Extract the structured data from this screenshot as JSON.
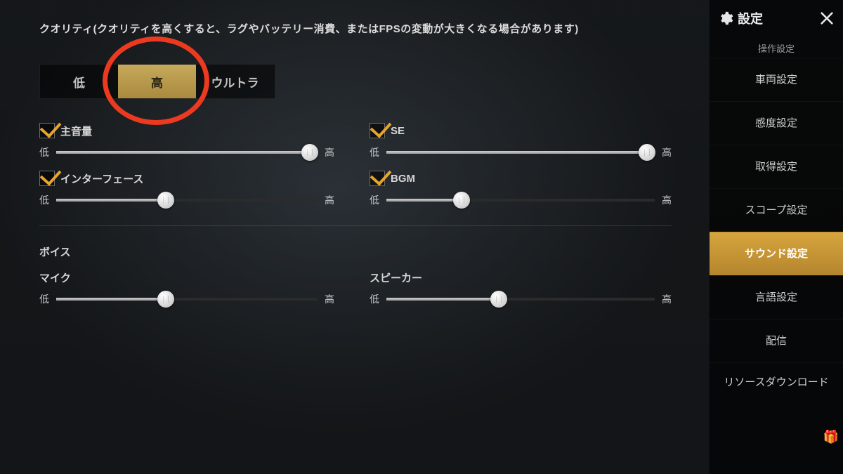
{
  "quality_note": "クオリティ(クオリティを高くすると、ラグやバッテリー消費、またはFPSの変動が大きくなる場合があります)",
  "quality_options": {
    "low": "低",
    "high": "高",
    "ultra": "ウルトラ",
    "selected": "high"
  },
  "labels": {
    "low": "低",
    "high": "高"
  },
  "sliders": {
    "master": {
      "label": "主音量",
      "checked": true,
      "value": 97
    },
    "se": {
      "label": "SE",
      "checked": true,
      "value": 97
    },
    "interface": {
      "label": "インターフェース",
      "checked": true,
      "value": 42
    },
    "bgm": {
      "label": "BGM",
      "checked": true,
      "value": 28
    },
    "mic": {
      "label": "マイク",
      "checked": false,
      "value": 42
    },
    "speaker": {
      "label": "スピーカー",
      "checked": false,
      "value": 42
    }
  },
  "voice_heading": "ボイス",
  "sidebar": {
    "title": "設定",
    "items_top_cut": "操作設定",
    "items": [
      "車両設定",
      "感度設定",
      "取得設定",
      "スコープ設定",
      "サウンド設定",
      "言語設定",
      "配信",
      "リソースダウンロード"
    ],
    "active_index": 4
  }
}
